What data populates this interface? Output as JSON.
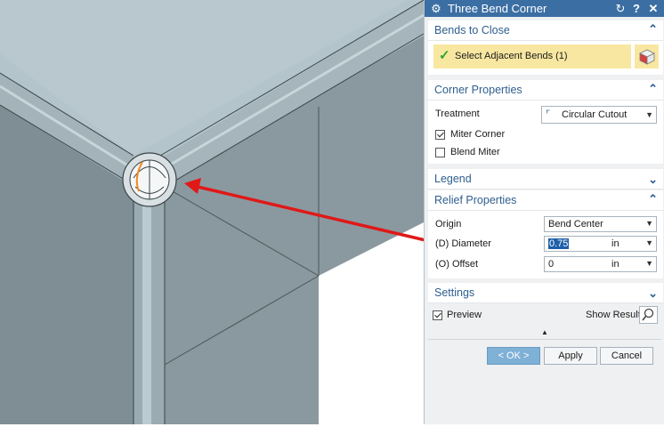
{
  "dialog": {
    "title": "Three Bend Corner",
    "icons": {
      "settings": "gear-icon",
      "reset": "reset-icon",
      "help": "help-icon",
      "close": "close-icon"
    }
  },
  "bends_to_close": {
    "header": "Bends to Close",
    "select_label": "Select Adjacent Bends (1)",
    "highlight_color": "#f8e7a1"
  },
  "corner_properties": {
    "header": "Corner Properties",
    "treatment_label": "Treatment",
    "treatment_value": "Circular Cutout",
    "miter_corner_label": "Miter Corner",
    "miter_corner_checked": true,
    "blend_miter_label": "Blend Miter",
    "blend_miter_checked": false
  },
  "legend": {
    "header": "Legend"
  },
  "relief_properties": {
    "header": "Relief Properties",
    "origin_label": "Origin",
    "origin_value": "Bend Center",
    "diameter_label": "(D) Diameter",
    "diameter_value": "0.75",
    "diameter_unit": "in",
    "offset_label": "(O) Offset",
    "offset_value": "0",
    "offset_unit": "in"
  },
  "settings": {
    "header": "Settings"
  },
  "footer": {
    "preview_label": "Preview",
    "preview_checked": true,
    "show_result_label": "Show Result",
    "ok_label": "< OK >",
    "apply_label": "Apply",
    "cancel_label": "Cancel"
  },
  "colors": {
    "title_bar": "#3b6fa3",
    "section_header_text": "#2e5f8e",
    "model_face_light": "#b3c3ca",
    "model_face_dark": "#7f9096",
    "annotation_arrow": "#e01818"
  }
}
